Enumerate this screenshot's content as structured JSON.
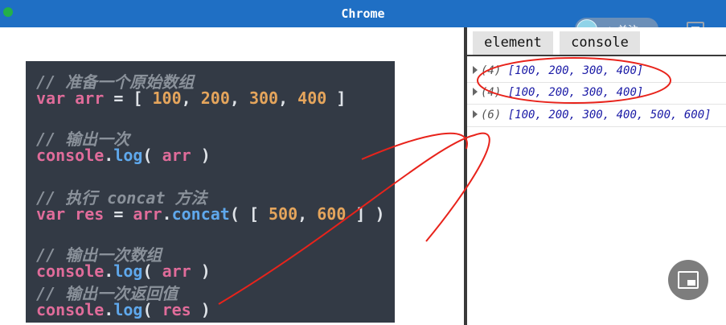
{
  "window": {
    "title": "Chrome"
  },
  "overlay": {
    "follow_label": "+ 关注"
  },
  "devtools": {
    "tabs": [
      {
        "label": "element"
      },
      {
        "label": "console"
      }
    ],
    "logs": [
      {
        "count": "(4)",
        "value": "[100, 200, 300, 400]"
      },
      {
        "count": "(4)",
        "value": "[100, 200, 300, 400]"
      },
      {
        "count": "(6)",
        "value": "[100, 200, 300, 400, 500, 600]"
      }
    ]
  },
  "code": {
    "comment1": "// 准备一个原始数组",
    "comment2": "// 输出一次",
    "comment3": "// 执行 concat 方法",
    "comment4": "// 输出一次数组",
    "comment5": "// 输出一次返回值",
    "kw_var": "var",
    "name_arr": "arr",
    "name_res": "res",
    "name_console": "console",
    "fn_log": "log",
    "fn_concat": "concat",
    "nums": [
      "100",
      "200",
      "300",
      "400",
      "500",
      "600"
    ]
  },
  "colors": {
    "title_bar": "#1f6fc4",
    "code_background": "#333a45",
    "annotation_red": "#e8231b"
  },
  "icons": [
    "window-dot-icon",
    "avatar-icon",
    "menu-icon",
    "picture-in-picture-icon",
    "expand-arrow-icon"
  ]
}
